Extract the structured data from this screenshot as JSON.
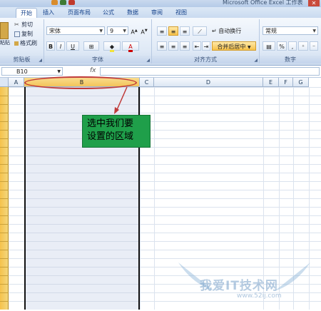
{
  "window": {
    "title": "Microsoft Office Excel 工作表"
  },
  "ribbon": {
    "tabs": [
      {
        "label": "开始",
        "active": true
      },
      {
        "label": "插入"
      },
      {
        "label": "页面布局"
      },
      {
        "label": "公式"
      },
      {
        "label": "数据"
      },
      {
        "label": "审阅"
      },
      {
        "label": "视图"
      }
    ],
    "clipboard": {
      "paste": "粘贴",
      "cut": "剪切",
      "copy": "复制",
      "format_painter": "格式刷",
      "label": "剪贴板"
    },
    "font": {
      "name": "宋体",
      "size": "9",
      "bold": "B",
      "italic": "I",
      "underline": "U",
      "label": "字体"
    },
    "alignment": {
      "wrap": "自动换行",
      "merge": "合并后居中",
      "label": "对齐方式"
    },
    "number": {
      "format": "常规",
      "percent": "%",
      "comma": ",",
      "label": "数字"
    }
  },
  "formula_bar": {
    "namebox": "B10",
    "fx": "fx"
  },
  "columns": [
    "A",
    "B",
    "C",
    "D",
    "E",
    "F",
    "G"
  ],
  "callout": {
    "line1": "选中我们要",
    "line2": "设置的区域"
  },
  "watermark": {
    "text": "我爱IT技术网",
    "url": "www.52ij.com"
  },
  "colors": {
    "accent": "#f3c45a",
    "callout_bg": "#1f9f4a",
    "annotation": "#c03a3a"
  }
}
